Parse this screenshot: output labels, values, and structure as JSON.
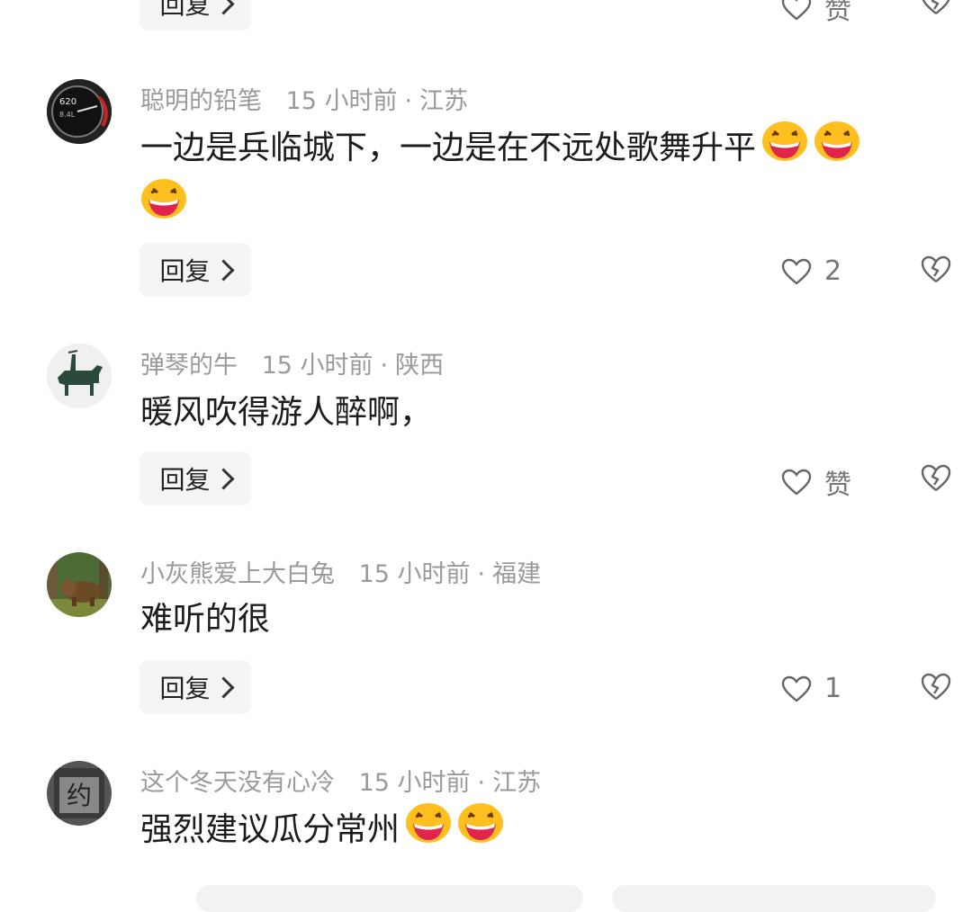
{
  "top_partial": {
    "reply_label": "回复",
    "like_label": "赞"
  },
  "comments": [
    {
      "username": "聪明的铅笔",
      "time": "15 小时前",
      "location": "江苏",
      "text": "一边是兵临城下，一边是在不远处歌舞升平",
      "emoji_count": 3,
      "reply_label": "回复",
      "like_label": "2",
      "avatar": "speedometer-avatar"
    },
    {
      "username": "弹琴的牛",
      "time": "15 小时前",
      "location": "陕西",
      "text": "暖风吹得游人醉啊，",
      "emoji_count": 0,
      "reply_label": "回复",
      "like_label": "赞",
      "avatar": "bull-silhouette-avatar"
    },
    {
      "username": "小灰熊爱上大白兔",
      "time": "15 小时前",
      "location": "福建",
      "text": "难听的很",
      "emoji_count": 0,
      "reply_label": "回复",
      "like_label": "1",
      "avatar": "bear-photo-avatar"
    },
    {
      "username": "这个冬天没有心冷",
      "time": "15 小时前",
      "location": "江苏",
      "text": "强烈建议瓜分常州",
      "emoji_count": 2,
      "avatar": "sign-photo-avatar",
      "avatar_glyph": "约"
    }
  ],
  "separator": "·",
  "icons": {
    "like": "heart-outline-icon",
    "dislike": "broken-heart-icon",
    "reply": "chevron-right-icon",
    "emoji": "grinning-laugh-emoji"
  },
  "colors": {
    "meta": "#9a9a9a",
    "reply_bg": "#f5f5f5",
    "emoji_face": "#ffbf1f",
    "emoji_mouth": "#e0244b"
  }
}
